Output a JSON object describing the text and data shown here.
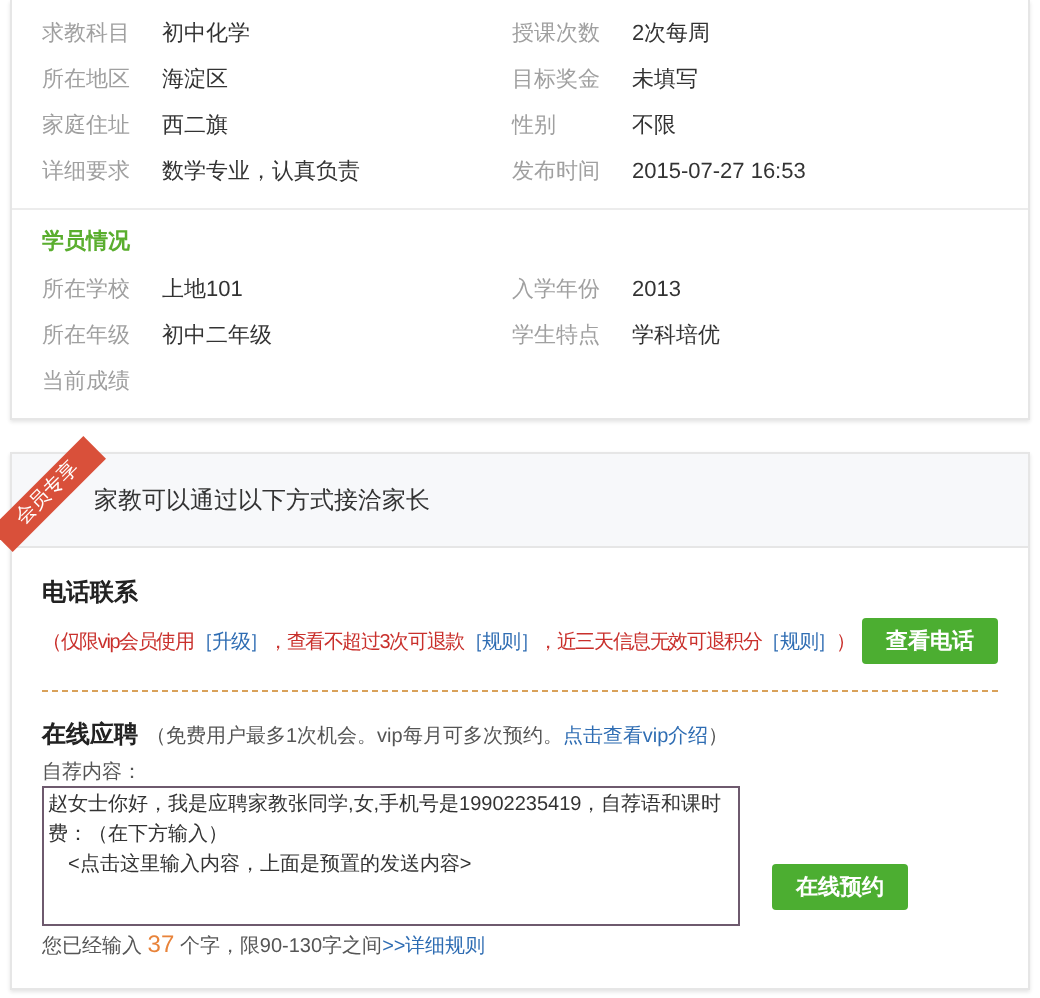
{
  "request_details": {
    "fields": [
      {
        "label": "求教科目",
        "value": "初中化学"
      },
      {
        "label": "授课次数",
        "value": "2次每周"
      },
      {
        "label": "所在地区",
        "value": "海淀区"
      },
      {
        "label": "目标奖金",
        "value": "未填写"
      },
      {
        "label": "家庭住址",
        "value": "西二旗"
      },
      {
        "label": "性别",
        "value": "不限"
      },
      {
        "label": "详细要求",
        "value": "数学专业，认真负责"
      },
      {
        "label": "发布时间",
        "value": "2015-07-27 16:53"
      }
    ]
  },
  "student_info": {
    "title": "学员情况",
    "fields": [
      {
        "label": "所在学校",
        "value": "上地101"
      },
      {
        "label": "入学年份",
        "value": "2013"
      },
      {
        "label": "所在年级",
        "value": "初中二年级"
      },
      {
        "label": "学生特点",
        "value": "学科培优"
      },
      {
        "label": "当前成绩"
      }
    ]
  },
  "contact": {
    "ribbon": "会员专享",
    "heading": "家教可以通过以下方式接洽家长",
    "phone": {
      "title": "电话联系",
      "note": [
        {
          "kind": "text",
          "text": "（仅限vip会员使用"
        },
        {
          "kind": "link",
          "text": "［升级］"
        },
        {
          "kind": "text",
          "text": "，查看不超过3次可退款"
        },
        {
          "kind": "link",
          "text": "［规则］"
        },
        {
          "kind": "text",
          "text": "，近三天信息无效可退积分"
        },
        {
          "kind": "link",
          "text": "［规则］"
        },
        {
          "kind": "text",
          "text": "）"
        }
      ],
      "button": "查看电话"
    },
    "apply": {
      "title": "在线应聘",
      "note": [
        {
          "kind": "text",
          "text": "（免费用户最多1次机会。vip每月可多次预约。"
        },
        {
          "kind": "link",
          "text": "点击查看vip介绍"
        },
        {
          "kind": "text",
          "text": "）"
        }
      ],
      "field_label": "自荐内容：",
      "message_lines": [
        "赵女士你好，我是应聘家教张同学,女,手机号是19902235419，自荐语和课时费：（在下方输入）",
        "<点击这里输入内容，上面是预置的发送内容>"
      ],
      "counter": [
        {
          "kind": "text",
          "text": "您已经输入 "
        },
        {
          "kind": "count",
          "text": "37"
        },
        {
          "kind": "text",
          "text": " 个字，限90-130字之间"
        },
        {
          "kind": "link",
          "text": ">>详细规则"
        }
      ],
      "button": "在线预约"
    }
  }
}
